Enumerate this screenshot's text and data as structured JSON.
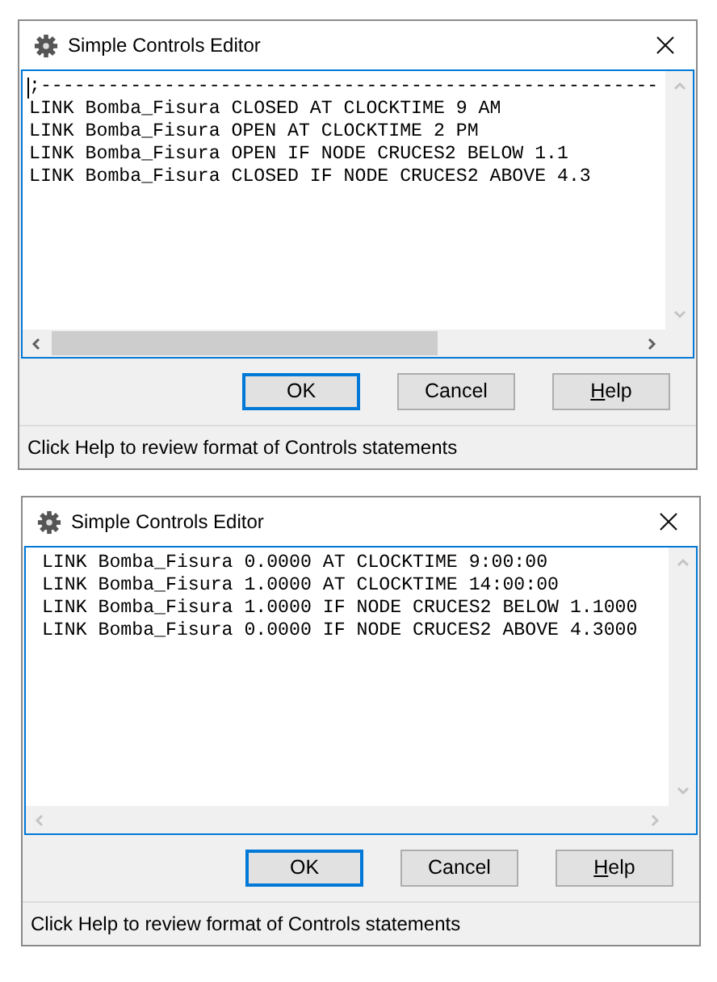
{
  "dialogs": [
    {
      "title": "Simple Controls Editor",
      "caret": true,
      "horizontal_scroll_enabled": true,
      "lines": [
        ";-------------------------------------------------------",
        "LINK Bomba_Fisura CLOSED AT CLOCKTIME 9 AM",
        "LINK Bomba_Fisura OPEN AT CLOCKTIME 2 PM",
        "LINK Bomba_Fisura OPEN IF NODE CRUCES2 BELOW 1.1",
        "LINK Bomba_Fisura CLOSED IF NODE CRUCES2 ABOVE 4.3"
      ],
      "buttons": [
        {
          "label": "OK",
          "default": true,
          "underline_first_letter": false
        },
        {
          "label": "Cancel",
          "default": false,
          "underline_first_letter": false
        },
        {
          "label": "Help",
          "default": false,
          "underline_first_letter": true
        }
      ],
      "status": "Click Help to review format of Controls statements"
    },
    {
      "title": "Simple Controls Editor",
      "caret": false,
      "horizontal_scroll_enabled": false,
      "lines": [
        " LINK Bomba_Fisura 0.0000 AT CLOCKTIME 9:00:00",
        " LINK Bomba_Fisura 1.0000 AT CLOCKTIME 14:00:00",
        " LINK Bomba_Fisura 1.0000 IF NODE CRUCES2 BELOW 1.1000",
        " LINK Bomba_Fisura 0.0000 IF NODE CRUCES2 ABOVE 4.3000"
      ],
      "buttons": [
        {
          "label": "OK",
          "default": true,
          "underline_first_letter": false
        },
        {
          "label": "Cancel",
          "default": false,
          "underline_first_letter": false
        },
        {
          "label": "Help",
          "default": false,
          "underline_first_letter": true
        }
      ],
      "status": "Click Help to review format of Controls statements"
    }
  ]
}
